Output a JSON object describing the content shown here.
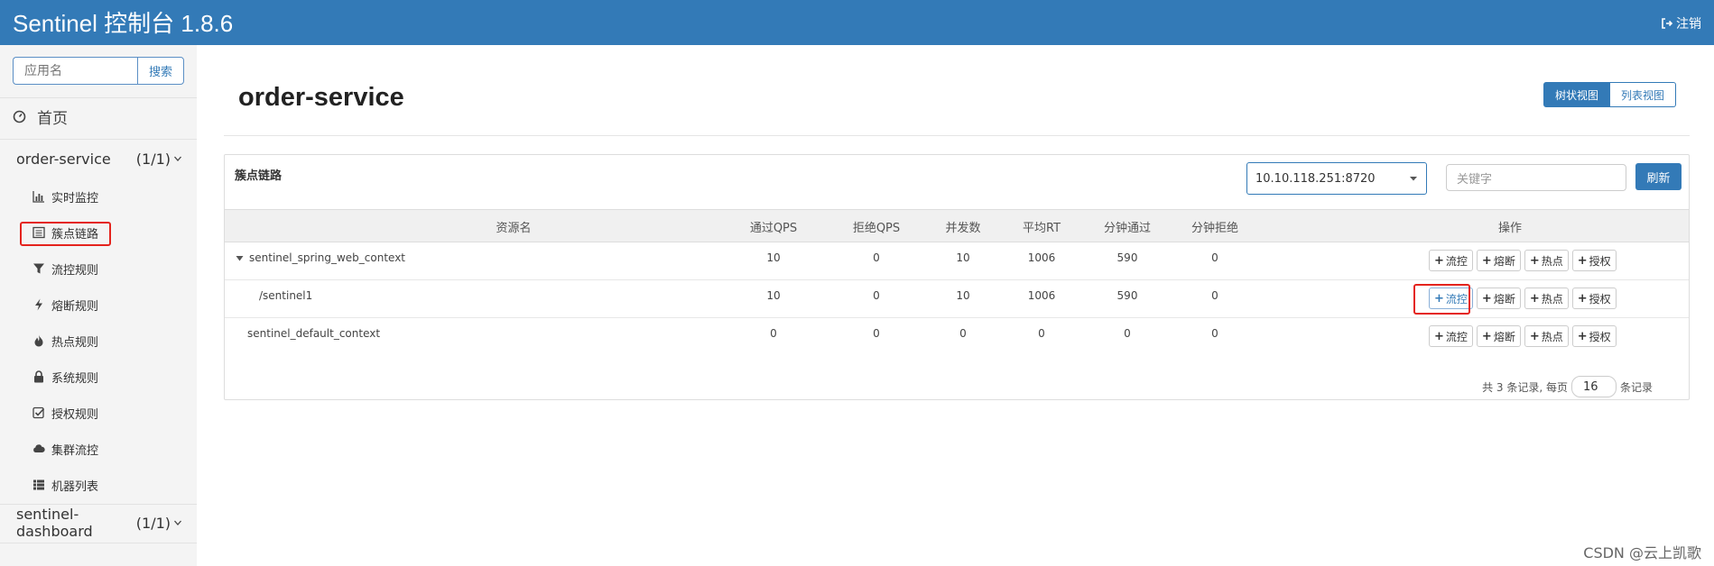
{
  "header": {
    "brand": "Sentinel 控制台 1.8.6",
    "logout_label": "注销",
    "logout_icon": "sign-out-icon",
    "bg_color": "#337ab7"
  },
  "sidebar": {
    "search_placeholder": "应用名",
    "search_button": "搜索",
    "home_label": "首页",
    "apps": [
      {
        "name": "order-service",
        "count": "(1/1)",
        "expanded": true
      },
      {
        "name": "sentinel-dashboard",
        "count": "(1/1)",
        "expanded": false
      }
    ],
    "menu": [
      {
        "label": "实时监控",
        "icon": "bar-chart-icon"
      },
      {
        "label": "簇点链路",
        "icon": "list-alt-icon",
        "highlighted": true
      },
      {
        "label": "流控规则",
        "icon": "filter-icon"
      },
      {
        "label": "熔断规则",
        "icon": "flash-icon"
      },
      {
        "label": "热点规则",
        "icon": "fire-icon"
      },
      {
        "label": "系统规则",
        "icon": "lock-icon"
      },
      {
        "label": "授权规则",
        "icon": "check-icon"
      },
      {
        "label": "集群流控",
        "icon": "cloud-icon"
      },
      {
        "label": "机器列表",
        "icon": "th-list-icon"
      }
    ]
  },
  "main": {
    "title": "order-service",
    "view_toggle": {
      "tree": "树状视图",
      "list": "列表视图",
      "active": "tree"
    },
    "panel": {
      "title": "簇点链路",
      "machine": "10.10.118.251:8720",
      "keyword_placeholder": "关键字",
      "refresh": "刷新"
    },
    "table": {
      "headers": [
        "资源名",
        "通过QPS",
        "拒绝QPS",
        "并发数",
        "平均RT",
        "分钟通过",
        "分钟拒绝",
        "操作"
      ],
      "rows": [
        {
          "name": "sentinel_spring_web_context",
          "pass_qps": "10",
          "block_qps": "0",
          "threads": "10",
          "avg_rt": "1006",
          "min_pass": "590",
          "min_block": "0",
          "expanded": true
        },
        {
          "name": "/sentinel1",
          "pass_qps": "10",
          "block_qps": "0",
          "threads": "10",
          "avg_rt": "1006",
          "min_pass": "590",
          "min_block": "0",
          "highlight_flow": true
        },
        {
          "name": "sentinel_default_context",
          "pass_qps": "0",
          "block_qps": "0",
          "threads": "0",
          "avg_rt": "0",
          "min_pass": "0",
          "min_block": "0"
        }
      ],
      "ops": [
        "流控",
        "熔断",
        "热点",
        "授权"
      ]
    },
    "pager": {
      "prefix": "共 3 条记录, 每页",
      "page_size": "16",
      "suffix": "条记录"
    }
  },
  "watermark": "CSDN @云上凯歌",
  "colors": {
    "primary": "#337ab7",
    "highlight": "#e4231d",
    "sidebar_bg": "#f4f4f4"
  }
}
